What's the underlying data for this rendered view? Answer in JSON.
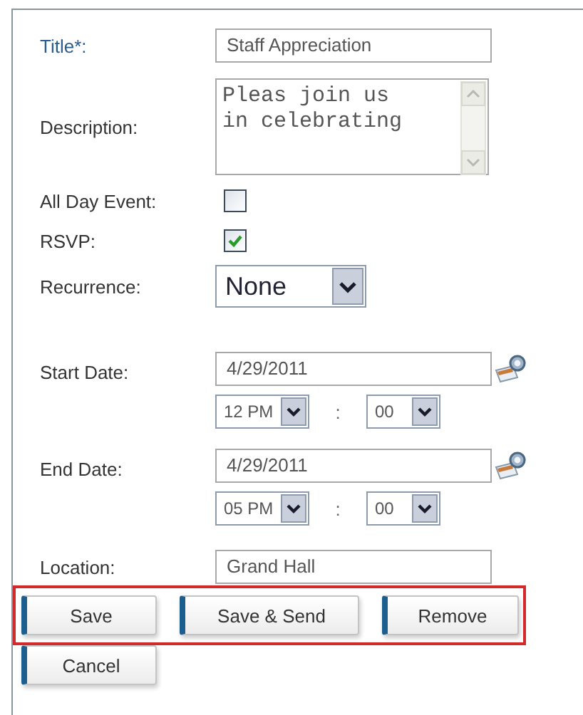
{
  "fields": [
    {
      "kind": "text",
      "label": "Title*:",
      "required": true,
      "value": "Staff Appreciation"
    },
    {
      "kind": "textarea",
      "label": "Description:",
      "required": false,
      "value": "Pleas join us\nin celebrating"
    },
    {
      "kind": "checkbox",
      "label": "All Day Event:",
      "required": false,
      "checked": false
    },
    {
      "kind": "checkbox",
      "label": "RSVP:",
      "required": false,
      "checked": true
    },
    {
      "kind": "select",
      "label": "Recurrence:",
      "required": false,
      "value": "None"
    },
    {
      "kind": "date",
      "label": "Start Date:",
      "required": false,
      "value": "4/29/2011",
      "hour": "12 PM",
      "separator": ":",
      "minute": "00"
    },
    {
      "kind": "date",
      "label": "End Date:",
      "required": false,
      "value": "4/29/2011",
      "hour": "05 PM",
      "separator": ":",
      "minute": "00"
    },
    {
      "kind": "text",
      "label": "Location:",
      "required": false,
      "value": "Grand Hall"
    }
  ],
  "button_rows": [
    {
      "highlighted": true,
      "buttons": [
        "Save",
        "Save & Send",
        "Remove"
      ]
    },
    {
      "highlighted": false,
      "buttons": [
        "Cancel"
      ]
    }
  ]
}
